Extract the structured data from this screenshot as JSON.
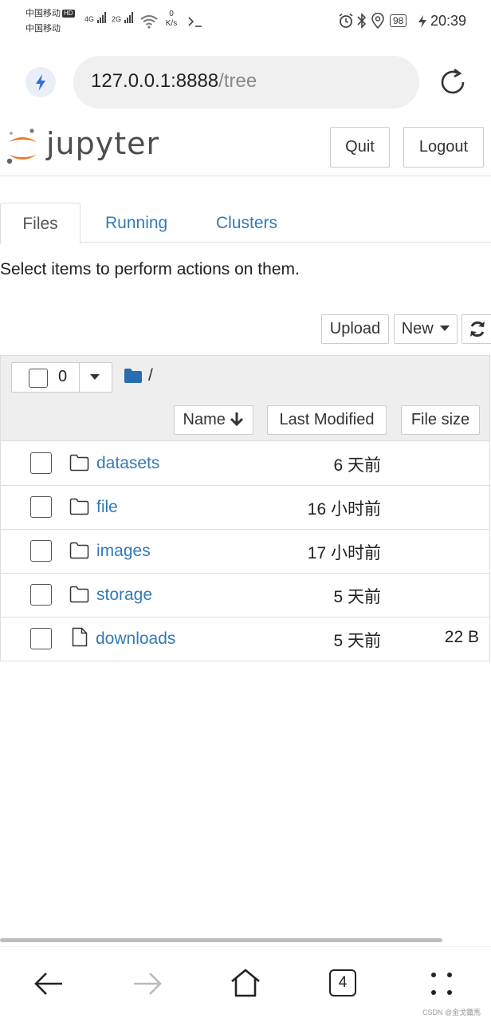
{
  "status_bar": {
    "carrier1": "中国移动",
    "carrier2": "中国移动",
    "hd": "HD",
    "net1": "4G",
    "net2": "2G",
    "speed_value": "0",
    "speed_unit": "K/s",
    "battery": "98",
    "time": "20:39"
  },
  "browser": {
    "url_host": "127.0.0.1:8888",
    "url_path": "/tree"
  },
  "header": {
    "brand": "jupyter",
    "quit_label": "Quit",
    "logout_label": "Logout"
  },
  "tabs": [
    {
      "label": "Files",
      "active": true
    },
    {
      "label": "Running",
      "active": false
    },
    {
      "label": "Clusters",
      "active": false
    }
  ],
  "hint": "Select items to perform actions on them.",
  "toolbar": {
    "upload_label": "Upload",
    "new_label": "New"
  },
  "list_header": {
    "selected_count": "0",
    "breadcrumb": "/",
    "col_name": "Name",
    "col_modified": "Last Modified",
    "col_size": "File size"
  },
  "files": [
    {
      "name": "datasets",
      "type": "folder",
      "modified": "6 天前",
      "size": ""
    },
    {
      "name": "file",
      "type": "folder",
      "modified": "16 小时前",
      "size": ""
    },
    {
      "name": "images",
      "type": "folder",
      "modified": "17 小时前",
      "size": ""
    },
    {
      "name": "storage",
      "type": "folder",
      "modified": "5 天前",
      "size": ""
    },
    {
      "name": "downloads",
      "type": "file",
      "modified": "5 天前",
      "size": "22 B"
    }
  ],
  "nav": {
    "tab_count": "4"
  },
  "watermark": "CSDN @金戈鐡馬",
  "colors": {
    "link": "#337ab7",
    "logo_orange": "#f37626",
    "folder_blue": "#2a6cb0"
  }
}
